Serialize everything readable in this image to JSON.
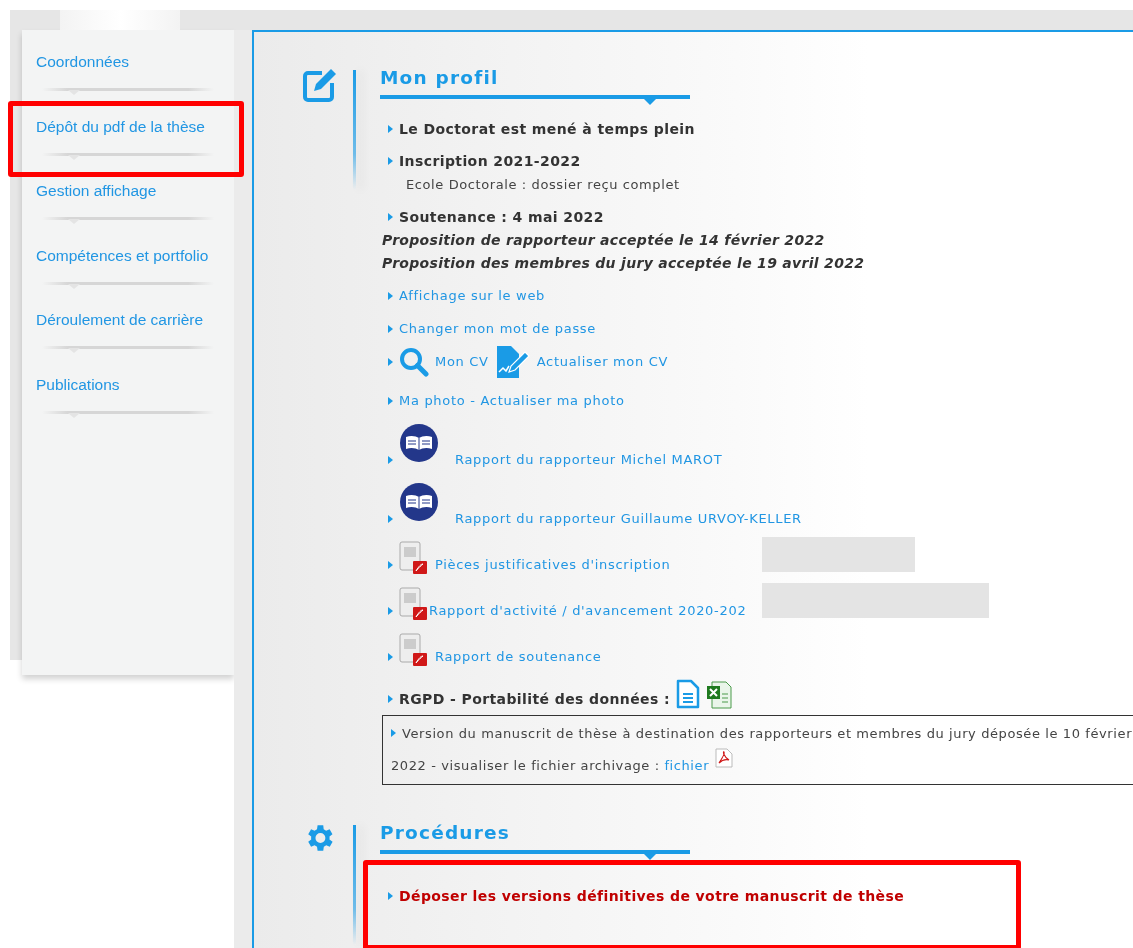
{
  "sidebar": {
    "items": [
      {
        "label": "Coordonnées",
        "highlighted": false
      },
      {
        "label": "Dépôt du pdf de la thèse",
        "highlighted": true
      },
      {
        "label": "Gestion affichage",
        "highlighted": false
      },
      {
        "label": "Compétences et portfolio",
        "highlighted": false
      },
      {
        "label": "Déroulement de carrière",
        "highlighted": false
      },
      {
        "label": "Publications",
        "highlighted": false
      }
    ]
  },
  "profile": {
    "title": "Mon profil",
    "items": [
      {
        "kind": "heading",
        "text": "Le Doctorat est mené à temps plein"
      },
      {
        "kind": "heading",
        "text": "Inscription 2021-2022"
      },
      {
        "kind": "note",
        "text": "Ecole Doctorale : dossier reçu complet"
      },
      {
        "kind": "heading",
        "text": "Soutenance : 4 mai 2022"
      },
      {
        "kind": "italic",
        "text": "Proposition de rapporteur acceptée le 14 février 2022"
      },
      {
        "kind": "italic",
        "text": "Proposition des membres du jury acceptée le 19 avril 2022"
      },
      {
        "kind": "link",
        "text": "Affichage sur le web"
      },
      {
        "kind": "link",
        "text": "Changer mon mot de passe"
      },
      {
        "kind": "cv",
        "view": "Mon CV",
        "update": "Actualiser mon CV"
      },
      {
        "kind": "link",
        "text": "Ma photo - Actualiser ma photo"
      },
      {
        "kind": "report",
        "text": "Rapport du rapporteur Michel MAROT"
      },
      {
        "kind": "report",
        "text": "Rapport du rapporteur Guillaume URVOY-KELLER"
      },
      {
        "kind": "pdf",
        "text": "Pièces justificatives d'inscription",
        "redacted": true
      },
      {
        "kind": "pdf",
        "text": "Rapport d'activité / d'avancement 2020-202",
        "redacted": true
      },
      {
        "kind": "pdf",
        "text": "Rapport de soutenance",
        "redacted": false
      },
      {
        "kind": "export",
        "text": "RGPD - Portabilité des données :"
      },
      {
        "kind": "notice",
        "text": "Version du manuscrit de thèse à destination des rapporteurs et membres du jury déposée le 10 février 2022 - visualiser le fichier archivage :",
        "link": "fichier"
      }
    ]
  },
  "procedures": {
    "title": "Procédures",
    "items": [
      {
        "text": "Déposer les versions définitives de votre manuscrit de thèse",
        "highlighted": true
      }
    ]
  }
}
